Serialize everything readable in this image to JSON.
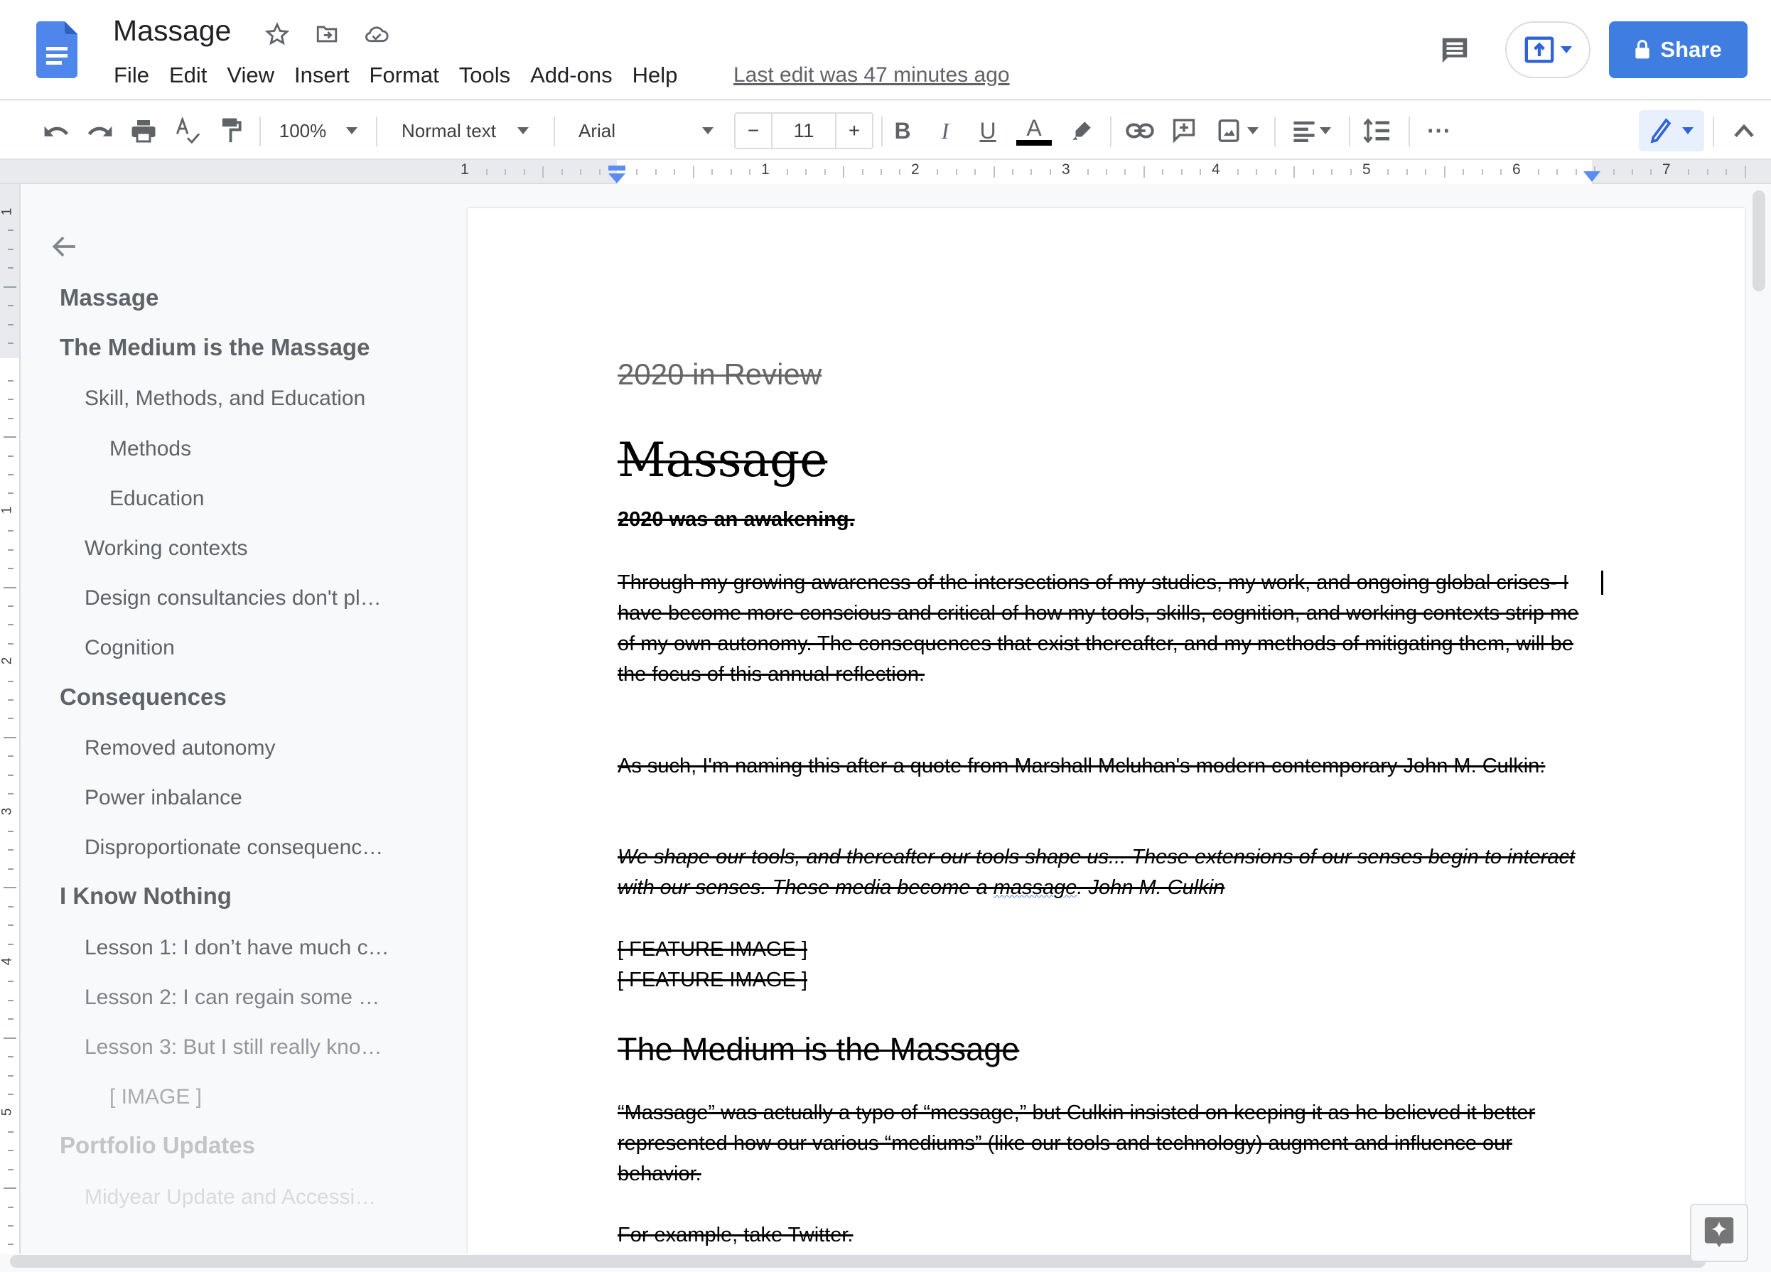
{
  "header": {
    "doc_title": "Massage",
    "title_icons": [
      "star-icon",
      "move-to-folder-icon",
      "cloud-saved-icon"
    ],
    "menu": [
      "File",
      "Edit",
      "View",
      "Insert",
      "Format",
      "Tools",
      "Add-ons",
      "Help"
    ],
    "last_edit": "Last edit was 47 minutes ago",
    "share_label": "Share",
    "accent_color": "#3f7de0"
  },
  "toolbar": {
    "zoom": "100%",
    "style": "Normal text",
    "font": "Arial",
    "font_size": "11",
    "minus": "−",
    "plus": "+",
    "bold": "B",
    "italic": "I",
    "underline": "U",
    "text_color": "A",
    "more": "⋯"
  },
  "ruler": {
    "labels": [
      "1",
      "1",
      "2",
      "3",
      "4",
      "5",
      "6",
      "7"
    ],
    "vertical_labels": [
      "1",
      "1",
      "2",
      "3",
      "4",
      "5"
    ]
  },
  "outline": {
    "items": [
      {
        "label": "Massage",
        "level": 1,
        "opacity": 1
      },
      {
        "label": "The Medium is the Massage",
        "level": 1,
        "opacity": 1
      },
      {
        "label": "Skill, Methods, and Education",
        "level": 2,
        "opacity": 1
      },
      {
        "label": "Methods",
        "level": 3,
        "opacity": 1
      },
      {
        "label": "Education",
        "level": 3,
        "opacity": 1
      },
      {
        "label": "Working contexts",
        "level": 2,
        "opacity": 1
      },
      {
        "label": "Design consultancies don't pl…",
        "level": 2,
        "opacity": 1
      },
      {
        "label": "Cognition",
        "level": 2,
        "opacity": 1
      },
      {
        "label": "Consequences",
        "level": 1,
        "opacity": 1
      },
      {
        "label": "Removed autonomy",
        "level": 2,
        "opacity": 1
      },
      {
        "label": "Power inbalance",
        "level": 2,
        "opacity": 1
      },
      {
        "label": "Disproportionate consequenc…",
        "level": 2,
        "opacity": 1
      },
      {
        "label": "I Know Nothing",
        "level": 1,
        "opacity": 1
      },
      {
        "label": "Lesson 1: I don’t have much c…",
        "level": 2,
        "opacity": 0.95
      },
      {
        "label": "Lesson 2: I can regain some …",
        "level": 2,
        "opacity": 0.8
      },
      {
        "label": "Lesson 3: But I still really kno…",
        "level": 2,
        "opacity": 0.65
      },
      {
        "label": "[ IMAGE ]",
        "level": 3,
        "opacity": 0.5
      },
      {
        "label": "Portfolio Updates",
        "level": 1,
        "opacity": 0.35
      },
      {
        "label": "Midyear Update and Accessi…",
        "level": 2,
        "opacity": 0.2
      }
    ]
  },
  "document": {
    "subtitle": "2020 in Review",
    "title": "Massage",
    "lead": "2020 was an awakening.",
    "p1": "Through my growing awareness of the intersections of my studies, my work, and ongoing global crises- I have become more conscious and critical of how my tools, skills, cognition, and working contexts strip me of my own autonomy. The consequences that exist thereafter, and my methods of mitigating them, will be the focus of this annual reflection.",
    "p2": "As such, I'm naming this after a quote from Marshall Mcluhan's modern contemporary John M. Culkin:",
    "quote_before": "We shape our tools, and thereafter our tools shape us... These extensions of our senses begin to interact with our senses. These media become a ",
    "quote_flagged": "massage",
    "quote_after": ". John M. Culkin",
    "feature_image_1": "[ FEATURE IMAGE ]",
    "feature_image_2": "[ FEATURE IMAGE ]",
    "h2": "The Medium is the Massage",
    "p3": "“Massage” was actually a typo of “message,” but Culkin insisted on keeping it as he believed it better represented how our various “mediums” (like our tools and technology) augment and influence our behavior.",
    "p4": "For example, take Twitter."
  }
}
